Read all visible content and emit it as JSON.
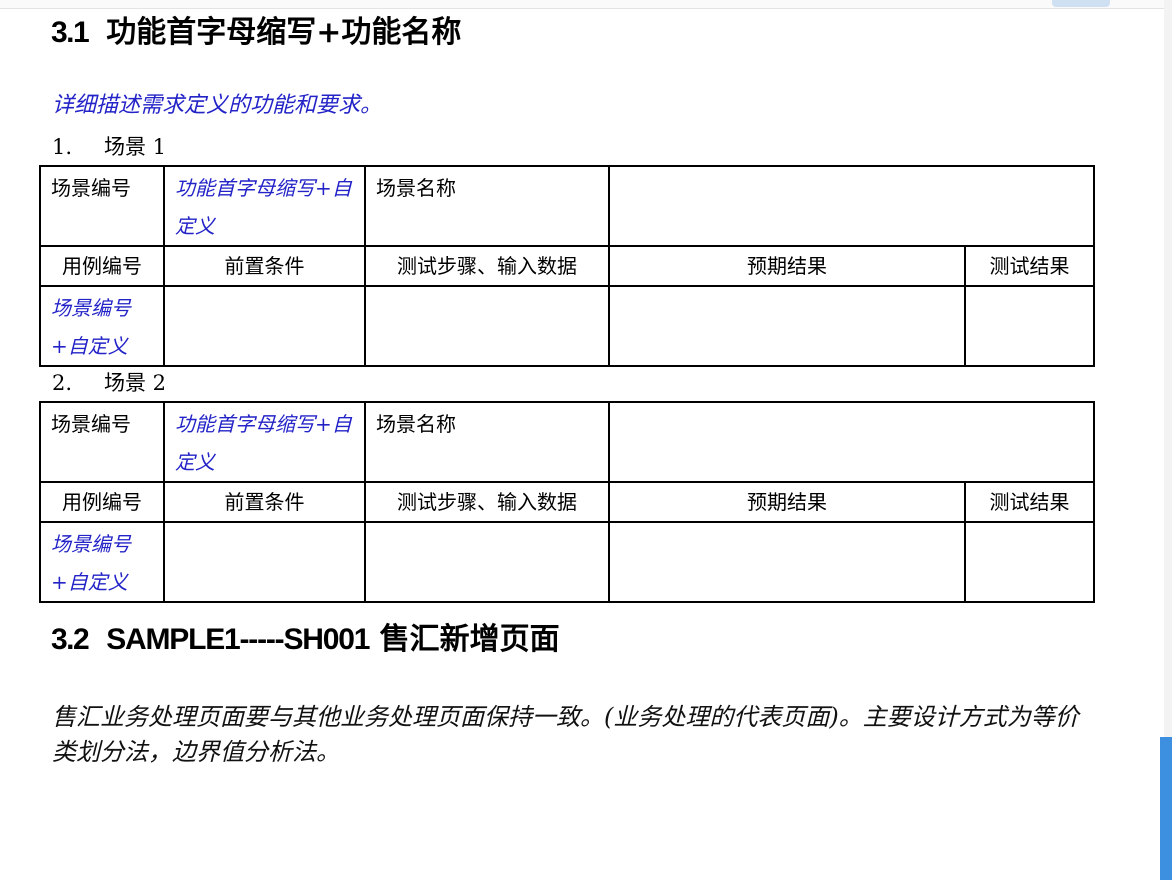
{
  "section_31": {
    "number": "3.1",
    "title": "功能首字母缩写+功能名称"
  },
  "description": "详细描述需求定义的功能和要求。",
  "scenes": [
    {
      "index": "1.",
      "label": "场景 1",
      "table": {
        "row1": {
          "scene_no_label": "场景编号",
          "scene_no_value": "功能首字母缩写+自定义",
          "scene_name_label": "场景名称",
          "scene_name_value": ""
        },
        "headers": [
          "用例编号",
          "前置条件",
          "测试步骤、输入数据",
          "预期结果",
          "测试结果"
        ],
        "data_row": [
          "场景编号+自定义",
          "",
          "",
          "",
          ""
        ]
      }
    },
    {
      "index": "2.",
      "label": "场景 2",
      "table": {
        "row1": {
          "scene_no_label": "场景编号",
          "scene_no_value": "功能首字母缩写+自定义",
          "scene_name_label": "场景名称",
          "scene_name_value": ""
        },
        "headers": [
          "用例编号",
          "前置条件",
          "测试步骤、输入数据",
          "预期结果",
          "测试结果"
        ],
        "data_row": [
          "场景编号+自定义",
          "",
          "",
          "",
          ""
        ]
      }
    }
  ],
  "section_32": {
    "number": "3.2",
    "latin": "SAMPLE1-----SH001",
    "title": "售汇新增页面"
  },
  "section_32_body": "售汇业务处理页面要与其他业务处理页面保持一致。(业务处理的代表页面)。主要设计方式为等价类划分法，边界值分析法。"
}
